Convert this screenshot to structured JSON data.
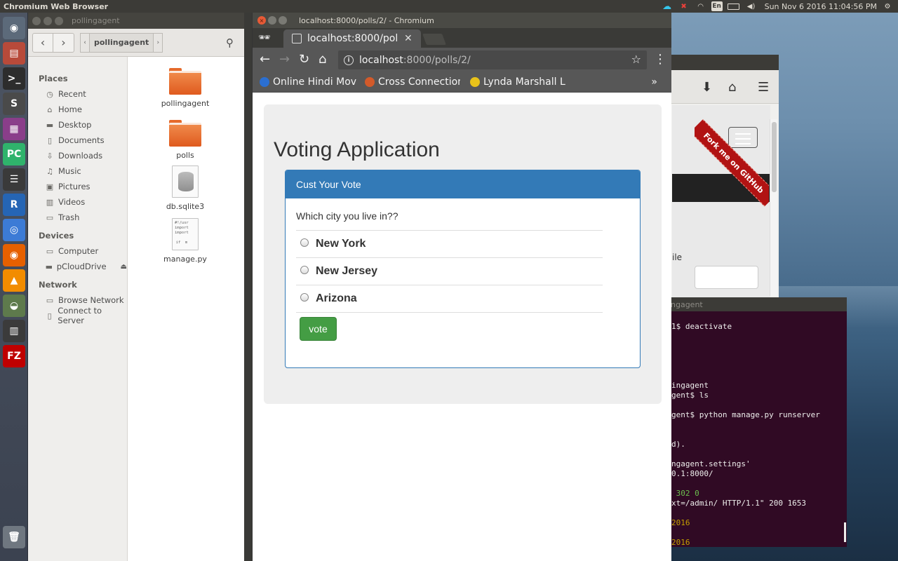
{
  "top_panel": {
    "app_title": "Chromium Web Browser",
    "lang_indicator": "En",
    "clock": "Sun Nov  6 2016 11:04:56 PM"
  },
  "launcher": {
    "items": [
      {
        "name": "dash-icon",
        "glyph": "◉",
        "color": "#5c6a7a"
      },
      {
        "name": "files-icon",
        "glyph": "▤",
        "color": "#b84a3a"
      },
      {
        "name": "terminal-icon",
        "glyph": ">_",
        "color": "#2d2d2d"
      },
      {
        "name": "sublime-icon",
        "glyph": "S",
        "color": "#4a4a4a"
      },
      {
        "name": "app-icon",
        "glyph": "▦",
        "color": "#8a3e8a"
      },
      {
        "name": "pycharm-icon",
        "glyph": "PC",
        "color": "#2fb36c"
      },
      {
        "name": "server-icon",
        "glyph": "☰",
        "color": "#3a3a3a"
      },
      {
        "name": "r-icon",
        "glyph": "R",
        "color": "#2565b5"
      },
      {
        "name": "chromium-icon",
        "glyph": "◎",
        "color": "#3c7bd6"
      },
      {
        "name": "firefox-icon",
        "glyph": "◉",
        "color": "#e66000"
      },
      {
        "name": "vlc-icon",
        "glyph": "▲",
        "color": "#f28c00"
      },
      {
        "name": "monitor-icon",
        "glyph": "◒",
        "color": "#5e7a4c"
      },
      {
        "name": "workspace-icon",
        "glyph": "▥",
        "color": "#3b3b3b"
      },
      {
        "name": "filezilla-icon",
        "glyph": "FZ",
        "color": "#bf0000"
      },
      {
        "name": "trash-icon",
        "glyph": "🗑",
        "color": "#6f7780"
      }
    ]
  },
  "files": {
    "window_title": "pollingagent",
    "breadcrumb": "pollingagent",
    "places_header": "Places",
    "places": [
      {
        "icon": "clock-icon",
        "glyph": "◷",
        "label": "Recent"
      },
      {
        "icon": "home-icon",
        "glyph": "⌂",
        "label": "Home"
      },
      {
        "icon": "desktop-icon",
        "glyph": "▬",
        "label": "Desktop"
      },
      {
        "icon": "documents-icon",
        "glyph": "▯",
        "label": "Documents"
      },
      {
        "icon": "downloads-icon",
        "glyph": "⇩",
        "label": "Downloads"
      },
      {
        "icon": "music-icon",
        "glyph": "♫",
        "label": "Music"
      },
      {
        "icon": "pictures-icon",
        "glyph": "▣",
        "label": "Pictures"
      },
      {
        "icon": "videos-icon",
        "glyph": "▥",
        "label": "Videos"
      },
      {
        "icon": "trash-icon",
        "glyph": "▭",
        "label": "Trash"
      }
    ],
    "devices_header": "Devices",
    "devices": [
      {
        "icon": "computer-icon",
        "glyph": "▭",
        "label": "Computer"
      },
      {
        "icon": "drive-icon",
        "glyph": "▬",
        "label": "pCloudDrive"
      }
    ],
    "network_header": "Network",
    "network": [
      {
        "icon": "network-icon",
        "glyph": "▭",
        "label": "Browse Network"
      },
      {
        "icon": "server-icon",
        "glyph": "▯",
        "label": "Connect to Server"
      }
    ],
    "items": [
      {
        "type": "folder",
        "label": "pollingagent"
      },
      {
        "type": "folder",
        "label": "polls"
      },
      {
        "type": "database",
        "label": "db.sqlite3"
      },
      {
        "type": "python",
        "label": "manage.py"
      }
    ]
  },
  "chromium": {
    "window_title": "localhost:8000/polls/2/ - Chromium",
    "tab_title": "localhost:8000/poll",
    "url_host": "localhost",
    "url_rest": ":8000/polls/2/",
    "bookmarks": [
      {
        "label": "Online Hindi Mov",
        "color": "#2b6fd1"
      },
      {
        "label": "Cross Connection",
        "color": "#d35a2a"
      },
      {
        "label": "Lynda Marshall L",
        "color": "#e8c21a"
      }
    ]
  },
  "page": {
    "title": "Voting Application",
    "panel_heading": "Cust Your Vote",
    "question": "Which city you live in??",
    "choices": [
      "New York",
      "New Jersey",
      "Arizona"
    ],
    "vote_label": "vote"
  },
  "firefox": {
    "ribbon_text": "Fork me on GitHub",
    "partial_text": "ile"
  },
  "terminal": {
    "title": "ngagent",
    "lines": [
      {
        "text": "1$ deactivate",
        "color": "#eeeeec"
      },
      {
        "text": "ingagent",
        "color": "#eeeeec"
      },
      {
        "text": "gent$ ls",
        "color": "#eeeeec"
      },
      {
        "text": "gent$ python manage.py runserver",
        "color": "#eeeeec"
      },
      {
        "text": "d).",
        "color": "#eeeeec"
      },
      {
        "text": "ngagent.settings'",
        "color": "#eeeeec"
      },
      {
        "text": "0.1:8000/",
        "color": "#eeeeec"
      },
      {
        "text": " 302 0",
        "color": "#6bbf4e"
      },
      {
        "text": "xt=/admin/ HTTP/1.1\" 200 1653",
        "color": "#eeeeec"
      },
      {
        "text": "2016",
        "color": "#c4a000"
      },
      {
        "text": "2016",
        "color": "#c4a000"
      }
    ]
  }
}
